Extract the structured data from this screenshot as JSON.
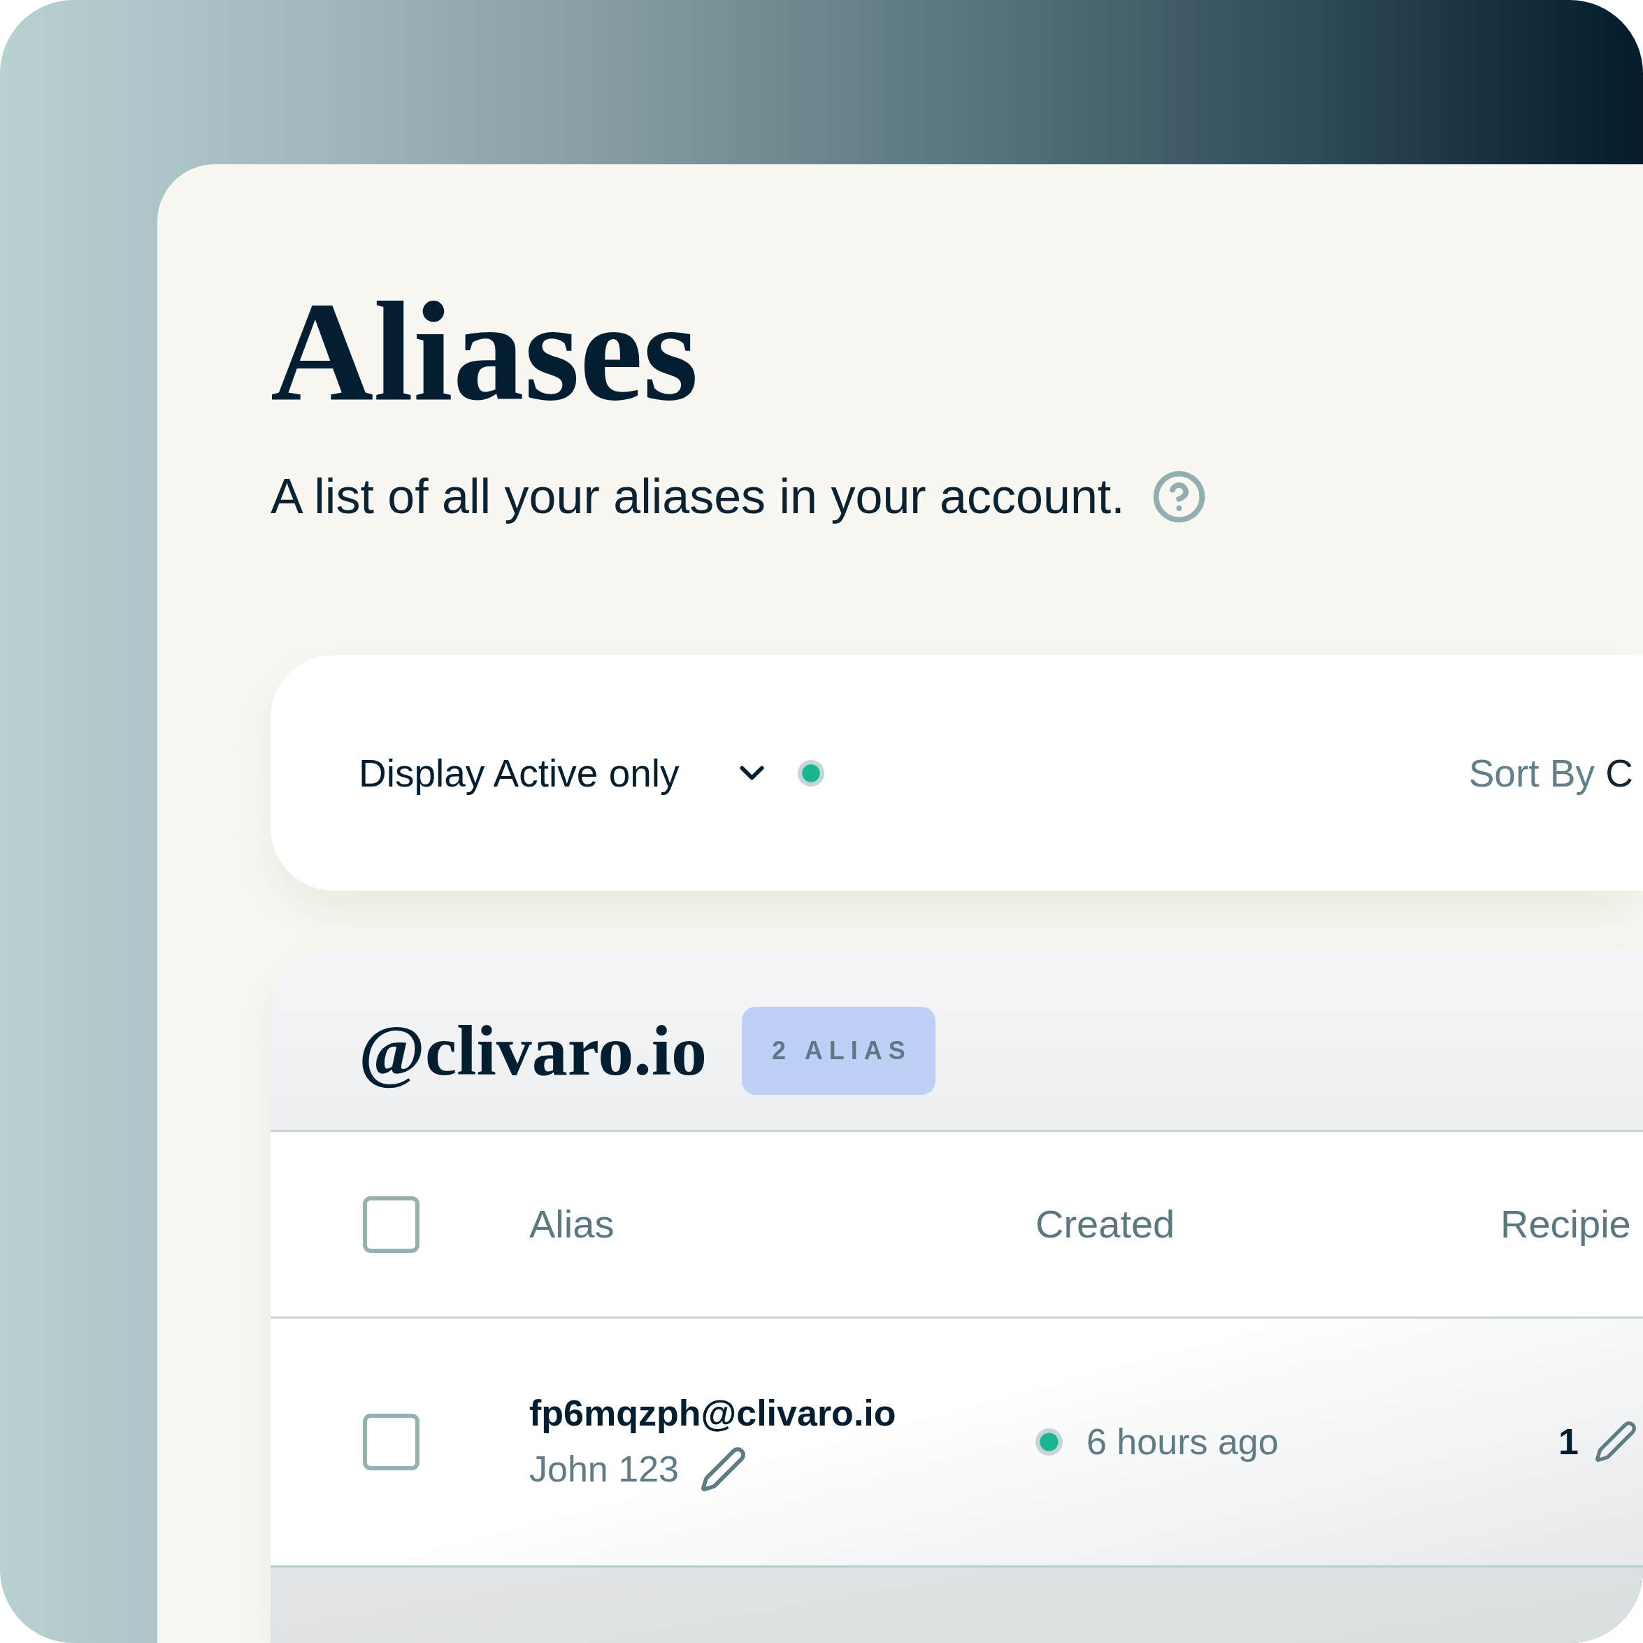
{
  "page": {
    "title": "Aliases",
    "subtitle": "A list of all your aliases in your account."
  },
  "filter_bar": {
    "display_filter": "Display Active only",
    "sort": {
      "label": "Sort By",
      "value": "C"
    }
  },
  "groups": [
    {
      "domain": "@clivaro.io",
      "badge": "2 ALIAS",
      "table": {
        "select_all": {
          "checked": false
        },
        "columns": [
          "Alias",
          "Created",
          "Recipie"
        ],
        "rows": [
          {
            "checked": false,
            "alias": "fp6mqzph@clivaro.io",
            "note": "John 123",
            "active": true,
            "created": "6 hours ago",
            "recipients": "1"
          }
        ]
      }
    }
  ]
}
